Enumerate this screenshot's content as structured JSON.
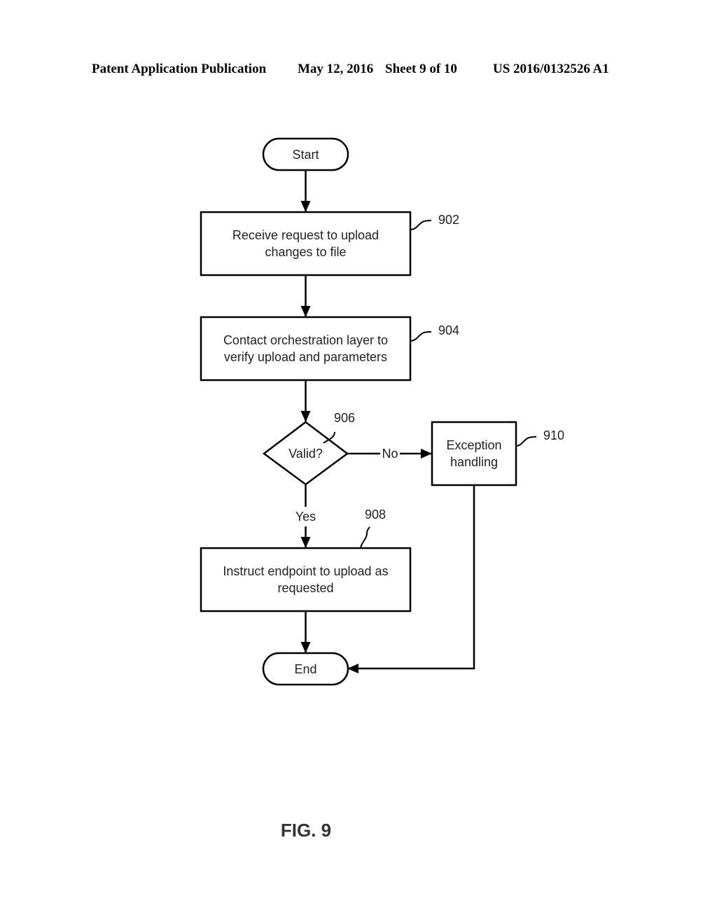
{
  "header": {
    "publication": "Patent Application Publication",
    "date": "May 12, 2016",
    "sheet": "Sheet 9 of 10",
    "number": "US 2016/0132526 A1"
  },
  "diagram": {
    "nodes": {
      "start": {
        "type": "terminator",
        "label": "Start"
      },
      "n902": {
        "type": "process",
        "ref": "902",
        "lines": [
          "Receive request to upload",
          "changes to file"
        ]
      },
      "n904": {
        "type": "process",
        "ref": "904",
        "lines": [
          "Contact orchestration layer to",
          "verify upload and parameters"
        ]
      },
      "n906": {
        "type": "decision",
        "ref": "906",
        "label": "Valid?"
      },
      "n908": {
        "type": "process",
        "ref": "908",
        "lines": [
          "Instruct endpoint to upload as",
          "requested"
        ]
      },
      "n910": {
        "type": "process",
        "ref": "910",
        "lines": [
          "Exception",
          "handling"
        ]
      },
      "end": {
        "type": "terminator",
        "label": "End"
      }
    },
    "edges": [
      {
        "from": "start",
        "to": "n902",
        "label": ""
      },
      {
        "from": "n902",
        "to": "n904",
        "label": ""
      },
      {
        "from": "n904",
        "to": "n906",
        "label": ""
      },
      {
        "from": "n906",
        "to": "n910",
        "label": "No"
      },
      {
        "from": "n906",
        "to": "n908",
        "label": "Yes"
      },
      {
        "from": "n908",
        "to": "end",
        "label": ""
      },
      {
        "from": "n910",
        "to": "end",
        "label": ""
      }
    ]
  },
  "figure_label": "FIG. 9"
}
